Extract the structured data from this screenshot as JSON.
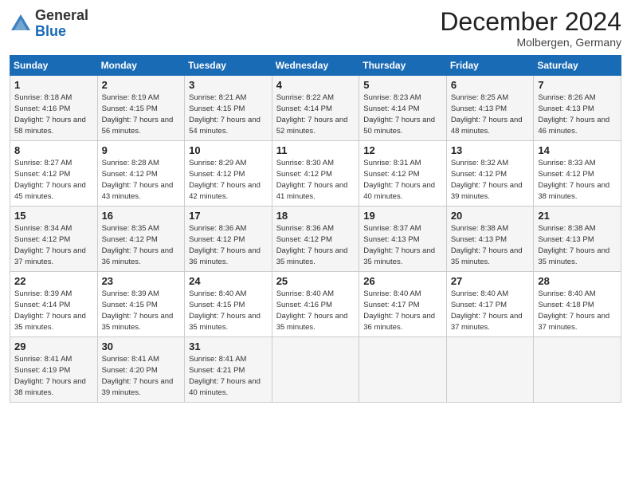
{
  "header": {
    "logo_general": "General",
    "logo_blue": "Blue",
    "month_title": "December 2024",
    "location": "Molbergen, Germany"
  },
  "calendar": {
    "days_of_week": [
      "Sunday",
      "Monday",
      "Tuesday",
      "Wednesday",
      "Thursday",
      "Friday",
      "Saturday"
    ],
    "weeks": [
      [
        null,
        null,
        null,
        {
          "day": "4",
          "sunrise": "8:22 AM",
          "sunset": "4:14 PM",
          "daylight": "7 hours and 52 minutes."
        },
        {
          "day": "5",
          "sunrise": "8:23 AM",
          "sunset": "4:14 PM",
          "daylight": "7 hours and 50 minutes."
        },
        {
          "day": "6",
          "sunrise": "8:25 AM",
          "sunset": "4:13 PM",
          "daylight": "7 hours and 48 minutes."
        },
        {
          "day": "7",
          "sunrise": "8:26 AM",
          "sunset": "4:13 PM",
          "daylight": "7 hours and 46 minutes."
        }
      ],
      [
        {
          "day": "1",
          "sunrise": "8:18 AM",
          "sunset": "4:16 PM",
          "daylight": "7 hours and 58 minutes."
        },
        {
          "day": "2",
          "sunrise": "8:19 AM",
          "sunset": "4:15 PM",
          "daylight": "7 hours and 56 minutes."
        },
        {
          "day": "3",
          "sunrise": "8:21 AM",
          "sunset": "4:15 PM",
          "daylight": "7 hours and 54 minutes."
        },
        {
          "day": "4",
          "sunrise": "8:22 AM",
          "sunset": "4:14 PM",
          "daylight": "7 hours and 52 minutes."
        },
        {
          "day": "5",
          "sunrise": "8:23 AM",
          "sunset": "4:14 PM",
          "daylight": "7 hours and 50 minutes."
        },
        {
          "day": "6",
          "sunrise": "8:25 AM",
          "sunset": "4:13 PM",
          "daylight": "7 hours and 48 minutes."
        },
        {
          "day": "7",
          "sunrise": "8:26 AM",
          "sunset": "4:13 PM",
          "daylight": "7 hours and 46 minutes."
        }
      ],
      [
        {
          "day": "8",
          "sunrise": "8:27 AM",
          "sunset": "4:12 PM",
          "daylight": "7 hours and 45 minutes."
        },
        {
          "day": "9",
          "sunrise": "8:28 AM",
          "sunset": "4:12 PM",
          "daylight": "7 hours and 43 minutes."
        },
        {
          "day": "10",
          "sunrise": "8:29 AM",
          "sunset": "4:12 PM",
          "daylight": "7 hours and 42 minutes."
        },
        {
          "day": "11",
          "sunrise": "8:30 AM",
          "sunset": "4:12 PM",
          "daylight": "7 hours and 41 minutes."
        },
        {
          "day": "12",
          "sunrise": "8:31 AM",
          "sunset": "4:12 PM",
          "daylight": "7 hours and 40 minutes."
        },
        {
          "day": "13",
          "sunrise": "8:32 AM",
          "sunset": "4:12 PM",
          "daylight": "7 hours and 39 minutes."
        },
        {
          "day": "14",
          "sunrise": "8:33 AM",
          "sunset": "4:12 PM",
          "daylight": "7 hours and 38 minutes."
        }
      ],
      [
        {
          "day": "15",
          "sunrise": "8:34 AM",
          "sunset": "4:12 PM",
          "daylight": "7 hours and 37 minutes."
        },
        {
          "day": "16",
          "sunrise": "8:35 AM",
          "sunset": "4:12 PM",
          "daylight": "7 hours and 36 minutes."
        },
        {
          "day": "17",
          "sunrise": "8:36 AM",
          "sunset": "4:12 PM",
          "daylight": "7 hours and 36 minutes."
        },
        {
          "day": "18",
          "sunrise": "8:36 AM",
          "sunset": "4:12 PM",
          "daylight": "7 hours and 35 minutes."
        },
        {
          "day": "19",
          "sunrise": "8:37 AM",
          "sunset": "4:13 PM",
          "daylight": "7 hours and 35 minutes."
        },
        {
          "day": "20",
          "sunrise": "8:38 AM",
          "sunset": "4:13 PM",
          "daylight": "7 hours and 35 minutes."
        },
        {
          "day": "21",
          "sunrise": "8:38 AM",
          "sunset": "4:13 PM",
          "daylight": "7 hours and 35 minutes."
        }
      ],
      [
        {
          "day": "22",
          "sunrise": "8:39 AM",
          "sunset": "4:14 PM",
          "daylight": "7 hours and 35 minutes."
        },
        {
          "day": "23",
          "sunrise": "8:39 AM",
          "sunset": "4:15 PM",
          "daylight": "7 hours and 35 minutes."
        },
        {
          "day": "24",
          "sunrise": "8:40 AM",
          "sunset": "4:15 PM",
          "daylight": "7 hours and 35 minutes."
        },
        {
          "day": "25",
          "sunrise": "8:40 AM",
          "sunset": "4:16 PM",
          "daylight": "7 hours and 35 minutes."
        },
        {
          "day": "26",
          "sunrise": "8:40 AM",
          "sunset": "4:17 PM",
          "daylight": "7 hours and 36 minutes."
        },
        {
          "day": "27",
          "sunrise": "8:40 AM",
          "sunset": "4:17 PM",
          "daylight": "7 hours and 37 minutes."
        },
        {
          "day": "28",
          "sunrise": "8:40 AM",
          "sunset": "4:18 PM",
          "daylight": "7 hours and 37 minutes."
        }
      ],
      [
        {
          "day": "29",
          "sunrise": "8:41 AM",
          "sunset": "4:19 PM",
          "daylight": "7 hours and 38 minutes."
        },
        {
          "day": "30",
          "sunrise": "8:41 AM",
          "sunset": "4:20 PM",
          "daylight": "7 hours and 39 minutes."
        },
        {
          "day": "31",
          "sunrise": "8:41 AM",
          "sunset": "4:21 PM",
          "daylight": "7 hours and 40 minutes."
        },
        null,
        null,
        null,
        null
      ]
    ]
  }
}
